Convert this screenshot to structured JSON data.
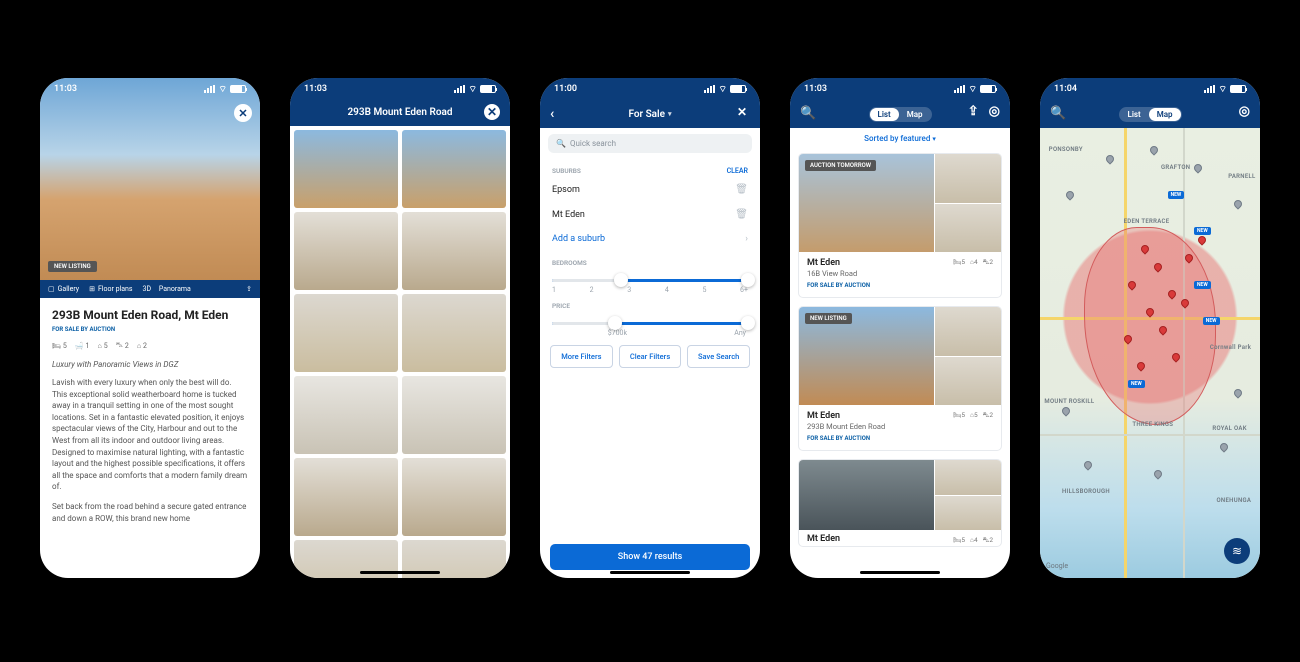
{
  "screen1": {
    "time": "11:03",
    "hero_badge": "NEW LISTING",
    "actions": {
      "gallery": "Gallery",
      "floorplans": "Floor plans",
      "panorama": "Panorama",
      "panorama_prefix": "3D"
    },
    "title": "293B Mount Eden Road, Mt Eden",
    "sale_type": "FOR SALE BY AUCTION",
    "specs": {
      "bed": "5",
      "bath": "1",
      "living": "5",
      "car": "2",
      "other": "2"
    },
    "tagline": "Luxury with Panoramic Views in DGZ",
    "para1": "Lavish with every luxury when only the best will do. This exceptional solid weatherboard home is tucked away in a tranquil setting in one of the most sought locations. Set in a fantastic elevated position, it enjoys spectacular views of the City, Harbour and out to the West from all its indoor and outdoor living areas. Designed to maximise natural lighting, with a fantastic layout and the highest possible specifications, it offers all the space and comforts that a modern family dream of.",
    "para2": "Set back from the road behind a secure gated entrance and down a ROW, this brand new home"
  },
  "screen2": {
    "time": "11:03",
    "title": "293B Mount Eden Road"
  },
  "screen3": {
    "time": "11:00",
    "title": "For Sale",
    "search_placeholder": "Quick search",
    "suburbs_label": "SUBURBS",
    "clear": "CLEAR",
    "suburbs": [
      "Epsom",
      "Mt Eden"
    ],
    "add_suburb": "Add a suburb",
    "bedrooms_label": "BEDROOMS",
    "bed_ticks": [
      "1",
      "2",
      "3",
      "4",
      "5",
      "6+"
    ],
    "price_label": "PRICE",
    "price_min": "$700k",
    "price_max": "Any",
    "buttons": {
      "more": "More Filters",
      "clear": "Clear Filters",
      "save": "Save Search"
    },
    "show": "Show 47 results"
  },
  "screen4": {
    "time": "11:03",
    "toggle": {
      "list": "List",
      "map": "Map"
    },
    "sort": "Sorted by featured",
    "listings": [
      {
        "label": "AUCTION TOMORROW",
        "suburb": "Mt Eden",
        "addr": "16B View Road",
        "sale": "FOR SALE BY AUCTION",
        "bed": "5",
        "living": "4",
        "car": "2"
      },
      {
        "label": "NEW LISTING",
        "suburb": "Mt Eden",
        "addr": "293B Mount Eden Road",
        "sale": "FOR SALE BY AUCTION",
        "bed": "5",
        "living": "5",
        "car": "2"
      },
      {
        "label": "",
        "suburb": "Mt Eden",
        "addr": "",
        "sale": "",
        "bed": "5",
        "living": "4",
        "car": "2"
      }
    ]
  },
  "screen5": {
    "time": "11:04",
    "toggle": {
      "list": "List",
      "map": "Map"
    },
    "neighborhoods": [
      "PONSONBY",
      "GRAFTON",
      "PARNELL",
      "EDEN TERRACE",
      "MOUNT ROSKILL",
      "THREE KINGS",
      "HILLSBOROUGH",
      "ONEHUNGA",
      "ROYAL OAK",
      "Cornwall Park"
    ],
    "new": "NEW",
    "google": "Google"
  }
}
